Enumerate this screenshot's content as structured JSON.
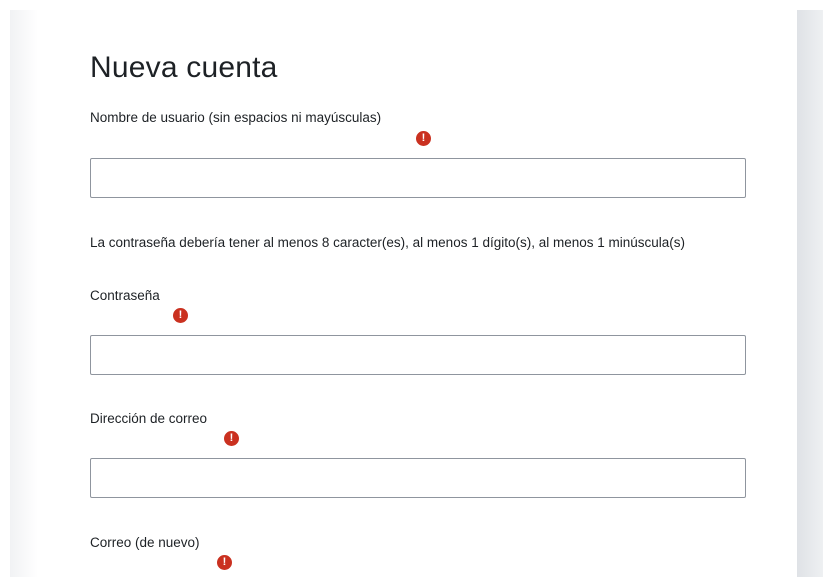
{
  "form": {
    "title": "Nueva cuenta",
    "password_policy": "La contraseña debería tener al menos 8 caracter(es), al menos 1 dígito(s), al menos 1 minúscula(s)",
    "required_icon": "exclamation-circle-icon",
    "required_color": "#ca3120",
    "fields": [
      {
        "label": "Nombre de usuario (sin espacios ni mayúsculas)",
        "value": "",
        "placeholder": ""
      },
      {
        "label": "Contraseña",
        "value": "",
        "placeholder": ""
      },
      {
        "label": "Dirección de correo",
        "value": "",
        "placeholder": ""
      },
      {
        "label": "Correo (de nuevo)",
        "value": "",
        "placeholder": ""
      }
    ]
  }
}
